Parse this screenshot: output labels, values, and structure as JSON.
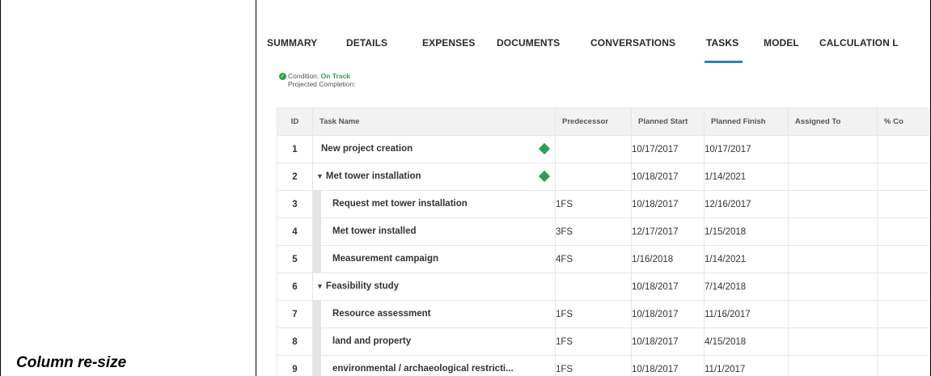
{
  "caption": "Column re-size",
  "tabs": [
    "SUMMARY",
    "DETAILS",
    "EXPENSES",
    "DOCUMENTS",
    "CONVERSATIONS",
    "TASKS",
    "MODEL",
    "CALCULATION L"
  ],
  "active_tab": "TASKS",
  "condition": {
    "label": "Condition:",
    "value": "On Track",
    "projected_label": "Projected Completion:",
    "value_color": "#2e9e4b"
  },
  "columns": [
    "ID",
    "Task Name",
    "Predecessor",
    "Planned Start",
    "Planned Finish",
    "Assigned To",
    "% Co"
  ],
  "rows": [
    {
      "id": "1",
      "name": "New project creation",
      "pred": "",
      "start": "10/17/2017",
      "finish": "10/17/2017",
      "level": 0,
      "group": false,
      "milestone": true
    },
    {
      "id": "2",
      "name": "Met tower installation",
      "pred": "",
      "start": "10/18/2017",
      "finish": "1/14/2021",
      "level": 0,
      "group": true,
      "milestone": true
    },
    {
      "id": "3",
      "name": "Request met tower installation",
      "pred": "1FS",
      "start": "10/18/2017",
      "finish": "12/16/2017",
      "level": 1,
      "group": false,
      "milestone": false
    },
    {
      "id": "4",
      "name": "Met tower installed",
      "pred": "3FS",
      "start": "12/17/2017",
      "finish": "1/15/2018",
      "level": 1,
      "group": false,
      "milestone": false
    },
    {
      "id": "5",
      "name": "Measurement campaign",
      "pred": "4FS",
      "start": "1/16/2018",
      "finish": "1/14/2021",
      "level": 1,
      "group": false,
      "milestone": false
    },
    {
      "id": "6",
      "name": "Feasibility study",
      "pred": "",
      "start": "10/18/2017",
      "finish": "7/14/2018",
      "level": 0,
      "group": true,
      "milestone": false
    },
    {
      "id": "7",
      "name": "Resource assessment",
      "pred": "1FS",
      "start": "10/18/2017",
      "finish": "11/16/2017",
      "level": 1,
      "group": false,
      "milestone": false
    },
    {
      "id": "8",
      "name": "land and property",
      "pred": "1FS",
      "start": "10/18/2017",
      "finish": "4/15/2018",
      "level": 1,
      "group": false,
      "milestone": false
    },
    {
      "id": "9",
      "name": "environmental / archaeological restricti...",
      "pred": "1FS",
      "start": "10/18/2017",
      "finish": "11/1/2017",
      "level": 1,
      "group": false,
      "milestone": false
    }
  ],
  "colors": {
    "accent": "#2d7fc1",
    "milestone": "#2e9e5b"
  },
  "icons": {
    "condition": "check-circle-icon",
    "group_toggle": "caret-down-icon",
    "milestone": "diamond-milestone-icon"
  }
}
